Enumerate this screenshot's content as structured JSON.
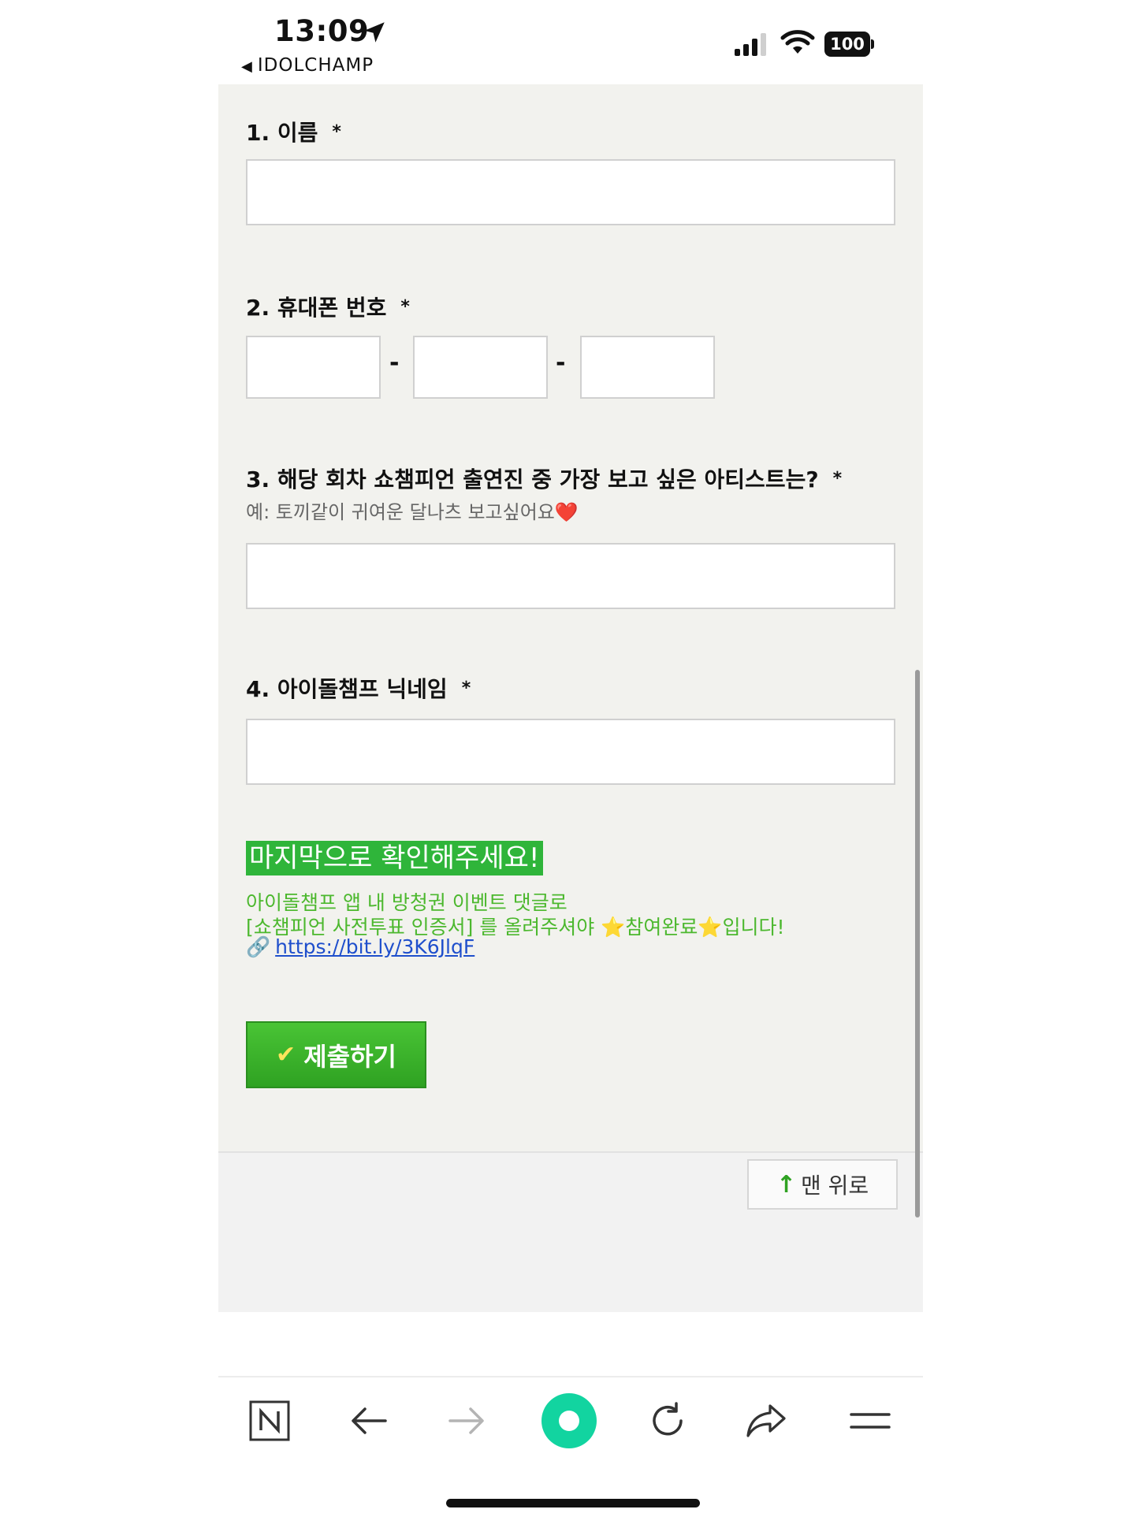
{
  "status_bar": {
    "time": "13:09",
    "back_app": "IDOLCHAMP",
    "battery": "100"
  },
  "form": {
    "q1": {
      "label": "1. 이름",
      "required": "*"
    },
    "q2": {
      "label": "2. 휴대폰 번호",
      "required": "*",
      "separator": "-"
    },
    "q3": {
      "label": "3. 해당 회차 쇼챔피언 출연진 중 가장 보고 싶은 아티스트는?",
      "required": "*",
      "hint": "예: 토끼같이 귀여운 달나츠 보고싶어요❤️"
    },
    "q4": {
      "label": "4. 아이돌챔프 닉네임",
      "required": "*"
    }
  },
  "notice": {
    "title": "마지막으로 확인해주세요!",
    "line1": "아이돌챔프 앱 내 방청권 이벤트 댓글로",
    "line2": "[쇼챔피언 사전투표 인증서] 를 올려주셔야 ⭐참여완료⭐입니다!",
    "link_icon": "🔗",
    "link": "https://bit.ly/3K6JlqF"
  },
  "submit": {
    "label": "제출하기",
    "icon": "check-icon"
  },
  "top_button": {
    "label": "맨 위로",
    "icon": "arrow-up-icon"
  },
  "toolbar": {
    "icons": [
      "naver-icon",
      "back-arrow-icon",
      "forward-arrow-icon",
      "green-dot-icon",
      "reload-icon",
      "share-icon",
      "menu-icon"
    ]
  },
  "colors": {
    "accent_green": "#2fb53a",
    "link_blue": "#1f4fcc",
    "notice_text": "#4cb82e"
  }
}
